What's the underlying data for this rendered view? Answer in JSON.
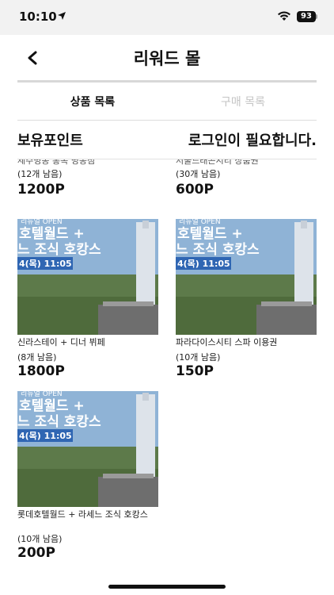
{
  "status": {
    "time": "10:10",
    "battery": "93"
  },
  "nav": {
    "title": "리워드 몰"
  },
  "tabs": [
    {
      "label": "상품 목록"
    },
    {
      "label": "구매 목록"
    }
  ],
  "points": {
    "label": "보유포인트",
    "value": "로그인이 필요합니다."
  },
  "products": [
    {
      "name": "제주명동 통폭 명동점",
      "stock": "(12개 남음)",
      "price": "1200P"
    },
    {
      "name": "서울드래곤시티 상품권",
      "stock": "(30개 남음)",
      "price": "600P"
    },
    {
      "name": "신라스테이 + 디너 뷔페",
      "stock": "(8개 남음)",
      "price": "1800P",
      "banner": {
        "tag": "리뉴얼 OPEN",
        "line1": "호텔월드 +",
        "line2": "느 조식 호캉스",
        "date": "4(목) 11:05"
      }
    },
    {
      "name": "파라다이스시티 스파 이용권",
      "stock": "(10개 남음)",
      "price": "150P",
      "banner": {
        "tag": "리뉴얼 OPEN",
        "line1": "호텔월드 +",
        "line2": "느 조식 호캉스",
        "date": "4(목) 11:05"
      }
    },
    {
      "name": "롯데호텔월드 + 라세느 조식 호캉스",
      "stock": "(10개 남음)",
      "price": "200P",
      "banner": {
        "tag": "리뉴얼 OPEN",
        "line1": "호텔월드 +",
        "line2": "느 조식 호캉스",
        "date": "4(목) 11:05"
      }
    }
  ]
}
